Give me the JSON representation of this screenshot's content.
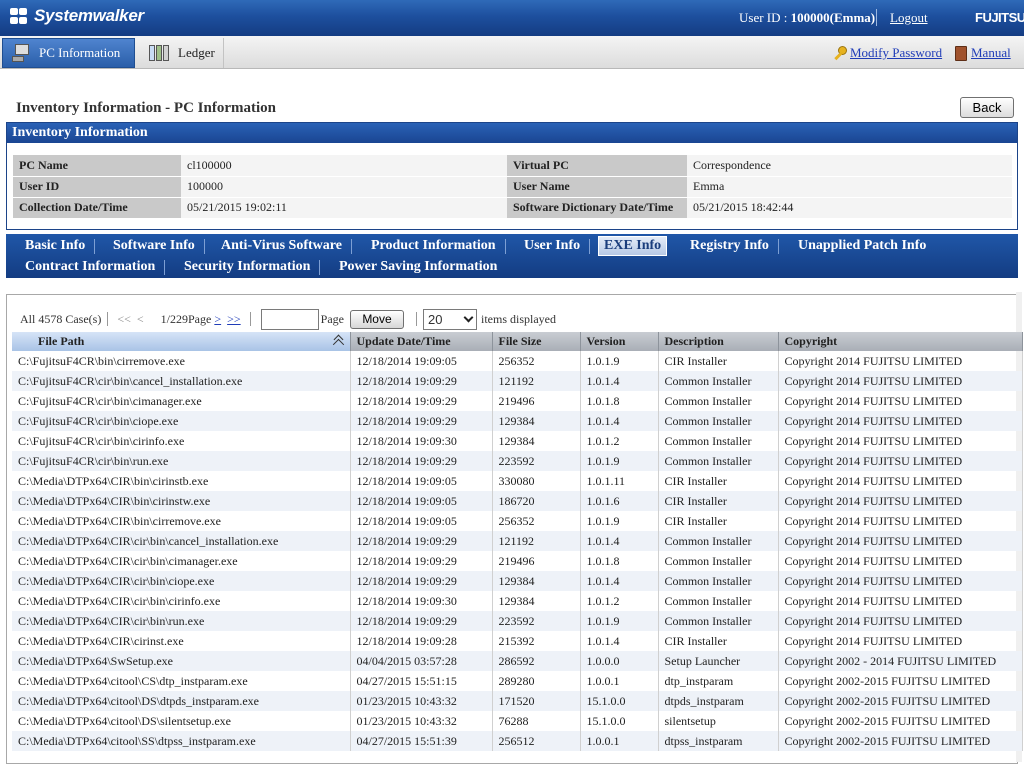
{
  "header": {
    "app_name": "Systemwalker",
    "user_label": "User ID : ",
    "user_value": "100000(Emma)",
    "logout": "Logout",
    "brand": "FUJITSU"
  },
  "nav": {
    "tabs": [
      {
        "label": "PC Information",
        "active": true,
        "icon": "pc-icon"
      },
      {
        "label": "Ledger",
        "active": false,
        "icon": "ledger-icon"
      }
    ],
    "links": {
      "modify_password": "Modify Password",
      "manual": "Manual"
    }
  },
  "page": {
    "title": "Inventory Information - PC Information",
    "back_label": "Back"
  },
  "inventory": {
    "section_title": "Inventory Information",
    "fields": [
      {
        "label": "PC Name",
        "value": "cl100000",
        "label2": "Virtual PC",
        "value2": "Correspondence"
      },
      {
        "label": "User ID",
        "value": "100000",
        "label2": "User Name",
        "value2": "Emma"
      },
      {
        "label": "Collection Date/Time",
        "value": "05/21/2015 19:02:11",
        "label2": "Software Dictionary Date/Time",
        "value2": "05/21/2015 18:42:44"
      }
    ]
  },
  "tabs": {
    "row1": [
      "Basic Info",
      "Software Info",
      "Anti-Virus Software",
      "Product Information",
      "User Info",
      "EXE Info",
      "Registry Info",
      "Unapplied Patch Info"
    ],
    "row2": [
      "Contract Information",
      "Security Information",
      "Power Saving Information"
    ],
    "active": "EXE Info"
  },
  "pager": {
    "total": "All 4578 Case(s)",
    "first": "<<",
    "prev": "<",
    "page_status": "1/229Page",
    "next": ">",
    "last": ">>",
    "page_input_value": "",
    "page_label": "Page",
    "move_label": "Move",
    "per_page": "20",
    "per_page_suffix": "items displayed"
  },
  "table": {
    "columns": [
      "File Path",
      "Update Date/Time",
      "File Size",
      "Version",
      "Description",
      "Copyright"
    ],
    "rows": [
      [
        "C:\\FujitsuF4CR\\bin\\cirremove.exe",
        "12/18/2014 19:09:05",
        "256352",
        "1.0.1.9",
        "CIR Installer",
        "Copyright 2014 FUJITSU LIMITED"
      ],
      [
        "C:\\FujitsuF4CR\\cir\\bin\\cancel_installation.exe",
        "12/18/2014 19:09:29",
        "121192",
        "1.0.1.4",
        "Common Installer",
        "Copyright 2014 FUJITSU LIMITED"
      ],
      [
        "C:\\FujitsuF4CR\\cir\\bin\\cimanager.exe",
        "12/18/2014 19:09:29",
        "219496",
        "1.0.1.8",
        "Common Installer",
        "Copyright 2014 FUJITSU LIMITED"
      ],
      [
        "C:\\FujitsuF4CR\\cir\\bin\\ciope.exe",
        "12/18/2014 19:09:29",
        "129384",
        "1.0.1.4",
        "Common Installer",
        "Copyright 2014 FUJITSU LIMITED"
      ],
      [
        "C:\\FujitsuF4CR\\cir\\bin\\cirinfo.exe",
        "12/18/2014 19:09:30",
        "129384",
        "1.0.1.2",
        "Common Installer",
        "Copyright 2014 FUJITSU LIMITED"
      ],
      [
        "C:\\FujitsuF4CR\\cir\\bin\\run.exe",
        "12/18/2014 19:09:29",
        "223592",
        "1.0.1.9",
        "Common Installer",
        "Copyright 2014 FUJITSU LIMITED"
      ],
      [
        "C:\\Media\\DTPx64\\CIR\\bin\\cirinstb.exe",
        "12/18/2014 19:09:05",
        "330080",
        "1.0.1.11",
        "CIR Installer",
        "Copyright 2014 FUJITSU LIMITED"
      ],
      [
        "C:\\Media\\DTPx64\\CIR\\bin\\cirinstw.exe",
        "12/18/2014 19:09:05",
        "186720",
        "1.0.1.6",
        "CIR Installer",
        "Copyright 2014 FUJITSU LIMITED"
      ],
      [
        "C:\\Media\\DTPx64\\CIR\\bin\\cirremove.exe",
        "12/18/2014 19:09:05",
        "256352",
        "1.0.1.9",
        "CIR Installer",
        "Copyright 2014 FUJITSU LIMITED"
      ],
      [
        "C:\\Media\\DTPx64\\CIR\\cir\\bin\\cancel_installation.exe",
        "12/18/2014 19:09:29",
        "121192",
        "1.0.1.4",
        "Common Installer",
        "Copyright 2014 FUJITSU LIMITED"
      ],
      [
        "C:\\Media\\DTPx64\\CIR\\cir\\bin\\cimanager.exe",
        "12/18/2014 19:09:29",
        "219496",
        "1.0.1.8",
        "Common Installer",
        "Copyright 2014 FUJITSU LIMITED"
      ],
      [
        "C:\\Media\\DTPx64\\CIR\\cir\\bin\\ciope.exe",
        "12/18/2014 19:09:29",
        "129384",
        "1.0.1.4",
        "Common Installer",
        "Copyright 2014 FUJITSU LIMITED"
      ],
      [
        "C:\\Media\\DTPx64\\CIR\\cir\\bin\\cirinfo.exe",
        "12/18/2014 19:09:30",
        "129384",
        "1.0.1.2",
        "Common Installer",
        "Copyright 2014 FUJITSU LIMITED"
      ],
      [
        "C:\\Media\\DTPx64\\CIR\\cir\\bin\\run.exe",
        "12/18/2014 19:09:29",
        "223592",
        "1.0.1.9",
        "Common Installer",
        "Copyright 2014 FUJITSU LIMITED"
      ],
      [
        "C:\\Media\\DTPx64\\CIR\\cirinst.exe",
        "12/18/2014 19:09:28",
        "215392",
        "1.0.1.4",
        "CIR Installer",
        "Copyright 2014 FUJITSU LIMITED"
      ],
      [
        "C:\\Media\\DTPx64\\SwSetup.exe",
        "04/04/2015 03:57:28",
        "286592",
        "1.0.0.0",
        "Setup Launcher",
        "Copyright 2002 - 2014 FUJITSU LIMITED"
      ],
      [
        "C:\\Media\\DTPx64\\citool\\CS\\dtp_instparam.exe",
        "04/27/2015 15:51:15",
        "289280",
        "1.0.0.1",
        "dtp_instparam",
        "Copyright 2002-2015 FUJITSU LIMITED"
      ],
      [
        "C:\\Media\\DTPx64\\citool\\DS\\dtpds_instparam.exe",
        "01/23/2015 10:43:32",
        "171520",
        "15.1.0.0",
        "dtpds_instparam",
        "Copyright 2002-2015 FUJITSU LIMITED"
      ],
      [
        "C:\\Media\\DTPx64\\citool\\DS\\silentsetup.exe",
        "01/23/2015 10:43:32",
        "76288",
        "15.1.0.0",
        "silentsetup",
        "Copyright 2002-2015 FUJITSU LIMITED"
      ],
      [
        "C:\\Media\\DTPx64\\citool\\SS\\dtpss_instparam.exe",
        "04/27/2015 15:51:39",
        "256512",
        "1.0.0.1",
        "dtpss_instparam",
        "Copyright 2002-2015 FUJITSU LIMITED"
      ]
    ]
  }
}
